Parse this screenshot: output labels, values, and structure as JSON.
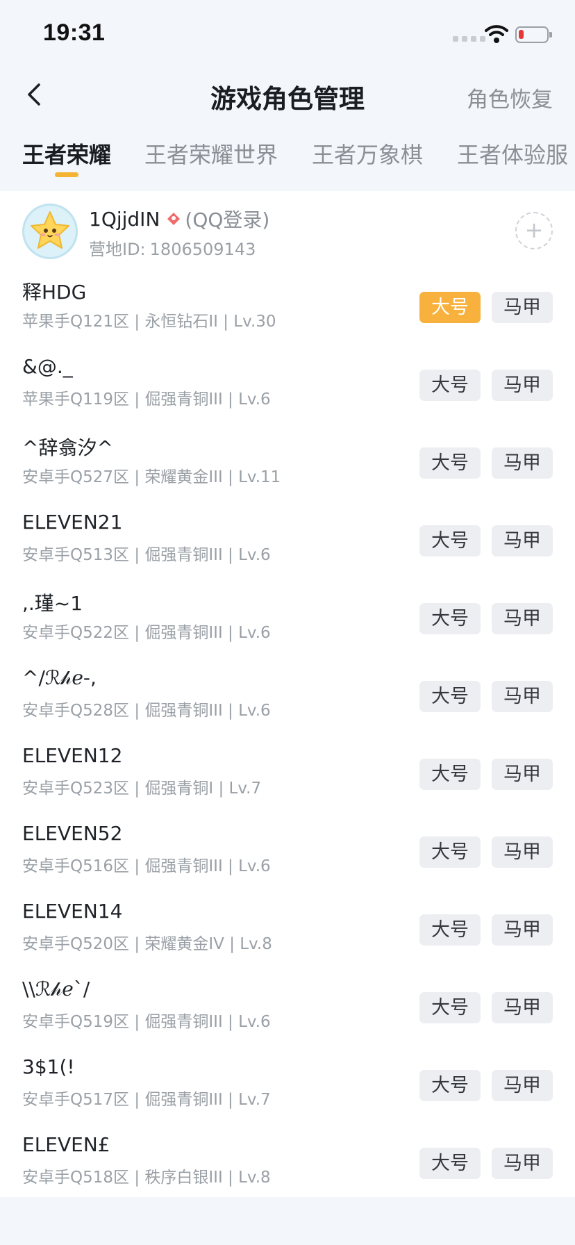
{
  "status_bar": {
    "time": "19:31"
  },
  "nav": {
    "title": "游戏角色管理",
    "right_action": "角色恢复"
  },
  "tabs": [
    {
      "label": "王者荣耀",
      "active": true
    },
    {
      "label": "王者荣耀世界",
      "active": false
    },
    {
      "label": "王者万象棋",
      "active": false
    },
    {
      "label": "王者体验服",
      "active": false
    }
  ],
  "account": {
    "name": "1QjjdIN",
    "login_type": "(QQ登录)",
    "id_label": "营地ID:",
    "id_value": "1806509143",
    "add_symbol": "+"
  },
  "buttons": {
    "main_label": "大号",
    "alt_label": "马甲"
  },
  "colors": {
    "accent": "#f7b13c",
    "tab_underline": "#f5b335"
  },
  "roles": [
    {
      "name": "释HDG",
      "sub": "苹果手Q121区 | 永恒钻石II | Lv.30",
      "main_selected": true
    },
    {
      "name": "&@._",
      "sub": "苹果手Q119区 | 倔强青铜III | Lv.6",
      "main_selected": false
    },
    {
      "name": "^辞翕汐^",
      "sub": "安卓手Q527区 | 荣耀黄金III | Lv.11",
      "main_selected": false
    },
    {
      "name": "ELEVEN21",
      "sub": "安卓手Q513区 | 倔强青铜III | Lv.6",
      "main_selected": false
    },
    {
      "name": ",.瑾~1",
      "sub": "安卓手Q522区 | 倔强青铜III | Lv.6",
      "main_selected": false
    },
    {
      "name": "^/ℛ𝒽ℯ-,",
      "sub": "安卓手Q528区 | 倔强青铜III | Lv.6",
      "main_selected": false
    },
    {
      "name": "ELEVEN12",
      "sub": "安卓手Q523区 | 倔强青铜I | Lv.7",
      "main_selected": false
    },
    {
      "name": "ELEVEN52",
      "sub": "安卓手Q516区 | 倔强青铜III | Lv.6",
      "main_selected": false
    },
    {
      "name": "ELEVEN14",
      "sub": "安卓手Q520区 | 荣耀黄金IV | Lv.8",
      "main_selected": false
    },
    {
      "name": "\\\\ℛ𝒽ℯ`/",
      "sub": "安卓手Q519区 | 倔强青铜III | Lv.6",
      "main_selected": false
    },
    {
      "name": "3$1(!",
      "sub": "安卓手Q517区 | 倔强青铜III | Lv.7",
      "main_selected": false
    },
    {
      "name": "ELEVEN£",
      "sub": "安卓手Q518区 | 秩序白银III | Lv.8",
      "main_selected": false
    }
  ]
}
